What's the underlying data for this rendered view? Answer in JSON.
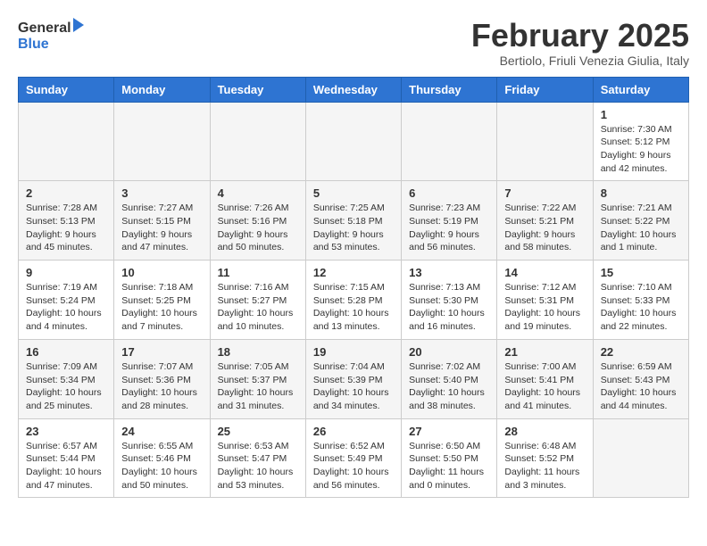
{
  "header": {
    "logo_general": "General",
    "logo_blue": "Blue",
    "month_year": "February 2025",
    "location": "Bertiolo, Friuli Venezia Giulia, Italy"
  },
  "calendar": {
    "days_of_week": [
      "Sunday",
      "Monday",
      "Tuesday",
      "Wednesday",
      "Thursday",
      "Friday",
      "Saturday"
    ],
    "weeks": [
      [
        {
          "day": "",
          "info": ""
        },
        {
          "day": "",
          "info": ""
        },
        {
          "day": "",
          "info": ""
        },
        {
          "day": "",
          "info": ""
        },
        {
          "day": "",
          "info": ""
        },
        {
          "day": "",
          "info": ""
        },
        {
          "day": "1",
          "info": "Sunrise: 7:30 AM\nSunset: 5:12 PM\nDaylight: 9 hours and 42 minutes."
        }
      ],
      [
        {
          "day": "2",
          "info": "Sunrise: 7:28 AM\nSunset: 5:13 PM\nDaylight: 9 hours and 45 minutes."
        },
        {
          "day": "3",
          "info": "Sunrise: 7:27 AM\nSunset: 5:15 PM\nDaylight: 9 hours and 47 minutes."
        },
        {
          "day": "4",
          "info": "Sunrise: 7:26 AM\nSunset: 5:16 PM\nDaylight: 9 hours and 50 minutes."
        },
        {
          "day": "5",
          "info": "Sunrise: 7:25 AM\nSunset: 5:18 PM\nDaylight: 9 hours and 53 minutes."
        },
        {
          "day": "6",
          "info": "Sunrise: 7:23 AM\nSunset: 5:19 PM\nDaylight: 9 hours and 56 minutes."
        },
        {
          "day": "7",
          "info": "Sunrise: 7:22 AM\nSunset: 5:21 PM\nDaylight: 9 hours and 58 minutes."
        },
        {
          "day": "8",
          "info": "Sunrise: 7:21 AM\nSunset: 5:22 PM\nDaylight: 10 hours and 1 minute."
        }
      ],
      [
        {
          "day": "9",
          "info": "Sunrise: 7:19 AM\nSunset: 5:24 PM\nDaylight: 10 hours and 4 minutes."
        },
        {
          "day": "10",
          "info": "Sunrise: 7:18 AM\nSunset: 5:25 PM\nDaylight: 10 hours and 7 minutes."
        },
        {
          "day": "11",
          "info": "Sunrise: 7:16 AM\nSunset: 5:27 PM\nDaylight: 10 hours and 10 minutes."
        },
        {
          "day": "12",
          "info": "Sunrise: 7:15 AM\nSunset: 5:28 PM\nDaylight: 10 hours and 13 minutes."
        },
        {
          "day": "13",
          "info": "Sunrise: 7:13 AM\nSunset: 5:30 PM\nDaylight: 10 hours and 16 minutes."
        },
        {
          "day": "14",
          "info": "Sunrise: 7:12 AM\nSunset: 5:31 PM\nDaylight: 10 hours and 19 minutes."
        },
        {
          "day": "15",
          "info": "Sunrise: 7:10 AM\nSunset: 5:33 PM\nDaylight: 10 hours and 22 minutes."
        }
      ],
      [
        {
          "day": "16",
          "info": "Sunrise: 7:09 AM\nSunset: 5:34 PM\nDaylight: 10 hours and 25 minutes."
        },
        {
          "day": "17",
          "info": "Sunrise: 7:07 AM\nSunset: 5:36 PM\nDaylight: 10 hours and 28 minutes."
        },
        {
          "day": "18",
          "info": "Sunrise: 7:05 AM\nSunset: 5:37 PM\nDaylight: 10 hours and 31 minutes."
        },
        {
          "day": "19",
          "info": "Sunrise: 7:04 AM\nSunset: 5:39 PM\nDaylight: 10 hours and 34 minutes."
        },
        {
          "day": "20",
          "info": "Sunrise: 7:02 AM\nSunset: 5:40 PM\nDaylight: 10 hours and 38 minutes."
        },
        {
          "day": "21",
          "info": "Sunrise: 7:00 AM\nSunset: 5:41 PM\nDaylight: 10 hours and 41 minutes."
        },
        {
          "day": "22",
          "info": "Sunrise: 6:59 AM\nSunset: 5:43 PM\nDaylight: 10 hours and 44 minutes."
        }
      ],
      [
        {
          "day": "23",
          "info": "Sunrise: 6:57 AM\nSunset: 5:44 PM\nDaylight: 10 hours and 47 minutes."
        },
        {
          "day": "24",
          "info": "Sunrise: 6:55 AM\nSunset: 5:46 PM\nDaylight: 10 hours and 50 minutes."
        },
        {
          "day": "25",
          "info": "Sunrise: 6:53 AM\nSunset: 5:47 PM\nDaylight: 10 hours and 53 minutes."
        },
        {
          "day": "26",
          "info": "Sunrise: 6:52 AM\nSunset: 5:49 PM\nDaylight: 10 hours and 56 minutes."
        },
        {
          "day": "27",
          "info": "Sunrise: 6:50 AM\nSunset: 5:50 PM\nDaylight: 11 hours and 0 minutes."
        },
        {
          "day": "28",
          "info": "Sunrise: 6:48 AM\nSunset: 5:52 PM\nDaylight: 11 hours and 3 minutes."
        },
        {
          "day": "",
          "info": ""
        }
      ]
    ]
  }
}
